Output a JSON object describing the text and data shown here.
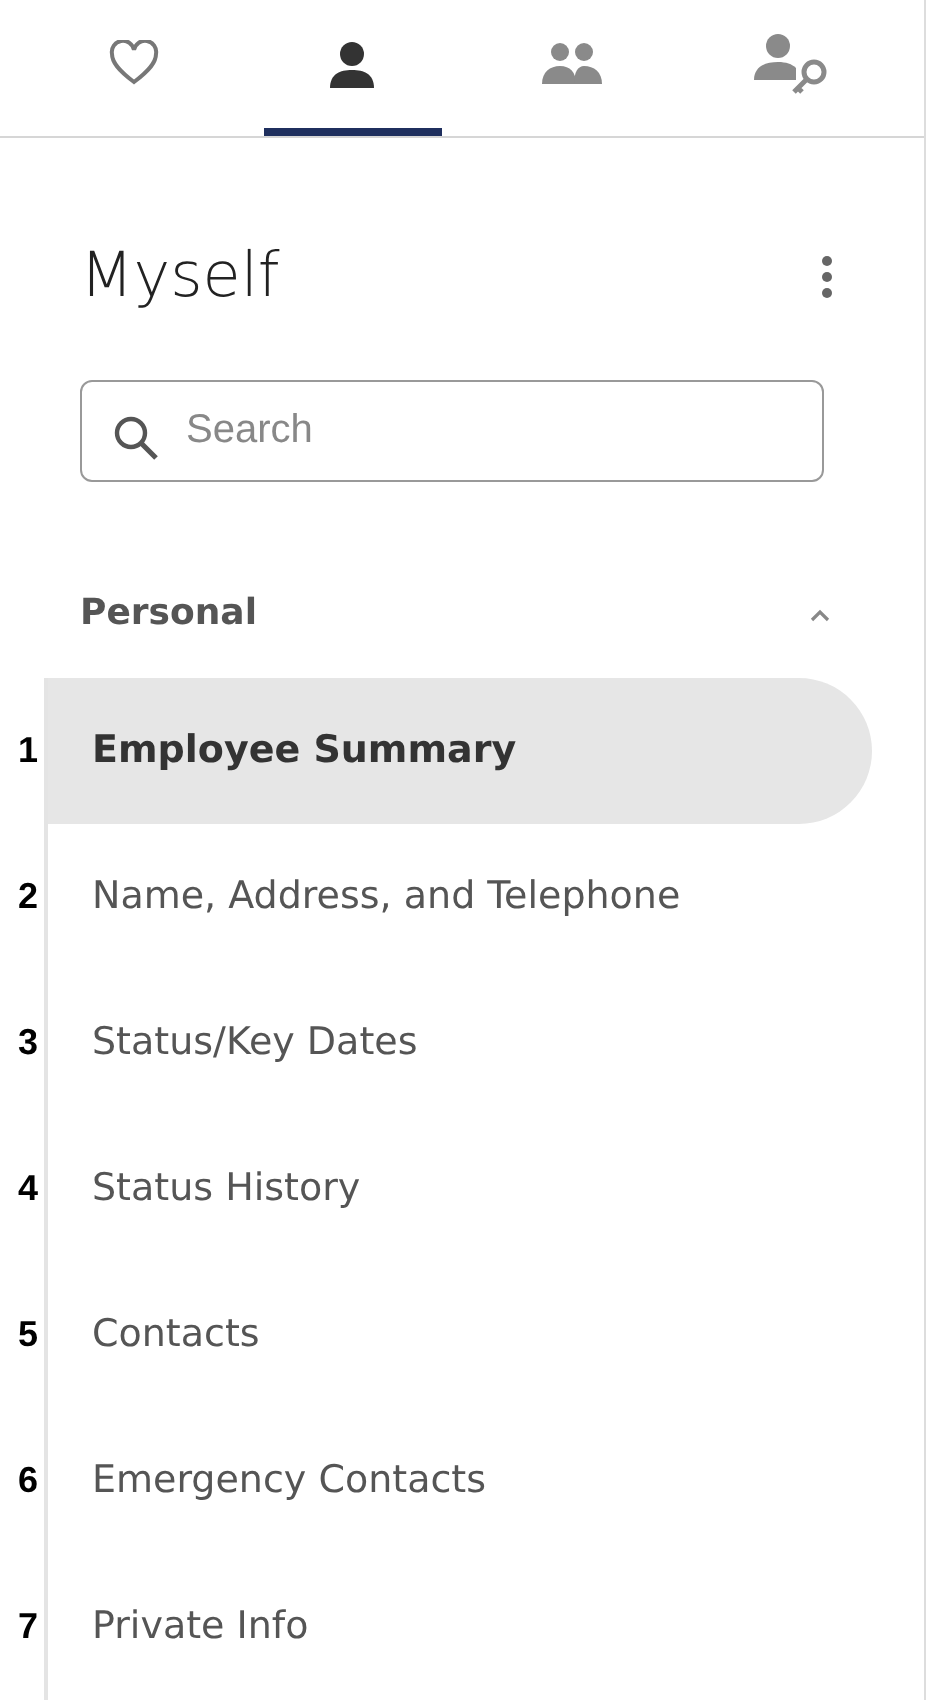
{
  "tabs": [
    {
      "kind": "heart",
      "selected": false
    },
    {
      "kind": "person",
      "selected": true
    },
    {
      "kind": "people",
      "selected": false
    },
    {
      "kind": "person-key",
      "selected": false
    }
  ],
  "title": "Myself",
  "search": {
    "placeholder": "Search"
  },
  "section": {
    "label": "Personal",
    "expanded": true
  },
  "items": [
    {
      "number": "1",
      "label": "Employee Summary",
      "selected": true
    },
    {
      "number": "2",
      "label": "Name, Address, and Telephone",
      "selected": false
    },
    {
      "number": "3",
      "label": "Status/Key Dates",
      "selected": false
    },
    {
      "number": "4",
      "label": "Status History",
      "selected": false
    },
    {
      "number": "5",
      "label": "Contacts",
      "selected": false
    },
    {
      "number": "6",
      "label": "Emergency Contacts",
      "selected": false
    },
    {
      "number": "7",
      "label": "Private Info",
      "selected": false
    }
  ]
}
